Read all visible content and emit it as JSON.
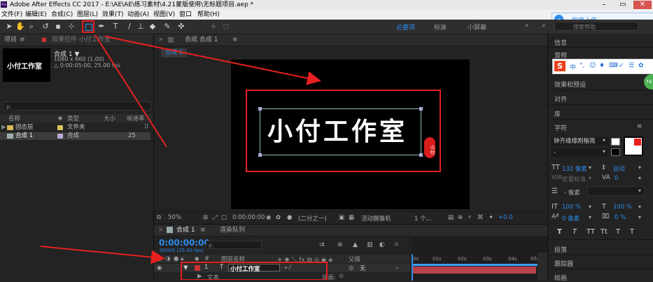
{
  "window": {
    "title": "Adobe After Effects CC 2017 - E:\\AE\\AE\\练习素材\\4.21蒙版使用\\无标题项目.aep *",
    "app_badge": "Ae"
  },
  "menu": [
    "文件(F)",
    "编辑(E)",
    "合成(C)",
    "图层(L)",
    "效果(T)",
    "动画(A)",
    "视图(V)",
    "窗口",
    "帮助(H)"
  ],
  "cloud": {
    "label": "拖拽上传"
  },
  "workspaces": [
    "必要项",
    "标准",
    "小屏幕"
  ],
  "search_help": {
    "placeholder": "搜索帮助"
  },
  "project": {
    "tab": "项目",
    "effects_tab": "效果控件 小付工作室",
    "comp_name": "合成 1 ▼",
    "comp_size": "1080 x 660 (1.00)",
    "comp_duration": "△ 0:00:05:00, 25.00 fps",
    "thumb_text": "小付工作室",
    "search_placeholder": "ρ.",
    "columns": [
      "名称",
      "类型",
      "大小",
      "帧速率"
    ],
    "rows": [
      {
        "name": "固态层",
        "type": "文件夹",
        "fps": ""
      },
      {
        "name": "合成 1",
        "type": "合成",
        "fps": "25"
      }
    ]
  },
  "comp_viewer": {
    "tab": "合成 合成 1",
    "sub_tab": "合成 1",
    "main_text": "小付工作室",
    "seal_text": "小付",
    "zoom": "50%",
    "time": "0:00:00:00",
    "resolution": "(二分之一)",
    "camera": "活动摄像机",
    "views": "1 个...",
    "exposure": "+0.0"
  },
  "timeline": {
    "comp_tab": "合成 1",
    "render_tab": "渲染队列",
    "timecode": "0:00:00:00",
    "timecode_sub": "00000 (25.00 fps)",
    "search_placeholder": "ρ.",
    "col_layer_name": "图层名称",
    "col_parent": "父级",
    "ruler": [
      "0s",
      "01s",
      "02s",
      "03s",
      "04s",
      "05s"
    ],
    "layer_index": "1",
    "layer_type": "T",
    "layer_name": "小付工作室",
    "parent_value": "无",
    "sub_row_label": "文本",
    "sub_row_right": "动画:"
  },
  "right_panel": {
    "info": "信息",
    "audio": "音频",
    "ime_items": [
      "中",
      "°,",
      "☺",
      "♦",
      "⌨",
      "✓",
      "☰",
      "✿"
    ],
    "badge": "74",
    "effects_presets": "效果和预设",
    "align": "对齐",
    "library": "库",
    "character": "字符",
    "font_name": "钟齐缘缘刚楷简",
    "font_style": "-",
    "font_size": "132 像素",
    "leading": "自动",
    "tracking_label": "度量标准",
    "tracking_value": "0",
    "stroke_size": "- 像素",
    "vscale": "100 %",
    "hscale": "100 %",
    "baseline": "0 像素",
    "tsume": "0 %",
    "style_buttons": [
      "T",
      "T",
      "TT",
      "Tt",
      "T",
      "T"
    ],
    "paragraph": "段落",
    "tracker": "跟踪器",
    "paint": "绘画"
  },
  "colors": {
    "highlight_red": "#e62020",
    "accent_blue": "#2d8ceb",
    "comp_bg": "#000000",
    "layer_bar": "#b8404a"
  }
}
